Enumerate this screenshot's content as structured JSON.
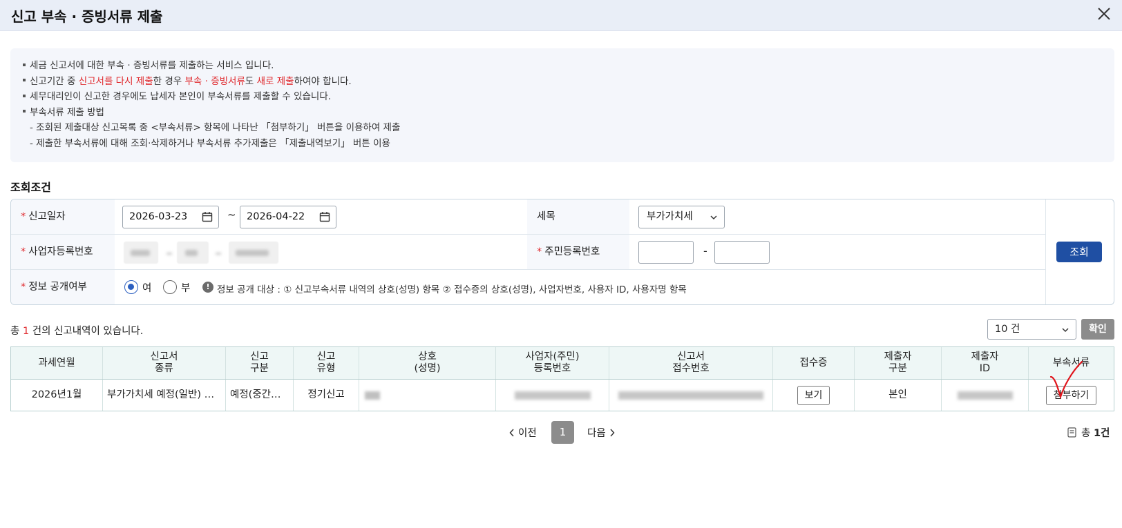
{
  "dialog": {
    "title": "신고 부속 · 증빙서류 제출"
  },
  "info": {
    "line1": "세금 신고서에 대한 부속 · 증빙서류를 제출하는 서비스 입니다.",
    "line2_a": "신고기간 중 ",
    "line2_b": "신고서를 다시 제출",
    "line2_c": "한 경우 ",
    "line2_d": "부속 · 증빙서류",
    "line2_e": "도 ",
    "line2_f": "새로 제출",
    "line2_g": "하여야 합니다.",
    "line3": "세무대리인이 신고한 경우에도 납세자 본인이 부속서류를 제출할 수 있습니다.",
    "line4": "부속서류 제출 방법",
    "line5": "- 조회된 제출대상 신고목록 중 <부속서류> 항목에 나타난 「첨부하기」 버튼을 이용하여 제출",
    "line6": "- 제출한 부속서류에 대해 조회·삭제하거나 부속서류 추가제출은 「제출내역보기」 버튼 이용"
  },
  "search": {
    "section_title": "조회조건",
    "required_mark": "*",
    "label_date": "신고일자",
    "date_from": "2026-03-23",
    "date_to": "2026-04-22",
    "tilde": "~",
    "label_tax_item": "세목",
    "tax_item_selected": "부가가치세",
    "label_business_no": "사업자등록번호",
    "label_resident_no": "주민등록번호",
    "dash": "-",
    "label_disclosure": "정보 공개여부",
    "opt_yes": "여",
    "opt_no": "부",
    "info_icon": "!",
    "disclosure_note": "정보 공개 대상 : ① 신고부속서류 내역의 상호(성명) 항목 ② 접수증의 상호(성명), 사업자번호, 사용자 ID, 사용자명 항목",
    "search_button": "조회"
  },
  "results": {
    "count_prefix": "총 ",
    "count": "1",
    "count_suffix": " 건의 신고내역이 있습니다.",
    "per_page": "10 건",
    "confirm_button": "확인",
    "columns": [
      "과세연월",
      "신고서\n종류",
      "신고\n구분",
      "신고\n유형",
      "상호\n(성명)",
      "사업자(주민)\n등록번호",
      "신고서\n접수번호",
      "접수증",
      "제출자\n구분",
      "제출자\nID",
      "부속서류"
    ],
    "row": {
      "period": "2026년1월",
      "report_type": "부가가치세 예정(일반) 신고",
      "report_class": "예정(중간예납)",
      "report_kind": "정기신고",
      "receipt_button": "보기",
      "submitter_type": "본인",
      "attach_button": "첨부하기"
    }
  },
  "pagination": {
    "prev": "이전",
    "current": "1",
    "next": "다음",
    "total_prefix": "총 ",
    "total_value": "1건"
  },
  "colors": {
    "accent": "#1f4fa3",
    "warning": "#e0292d",
    "header_bg": "#e9eef7",
    "grid_head": "#eef7f6"
  }
}
